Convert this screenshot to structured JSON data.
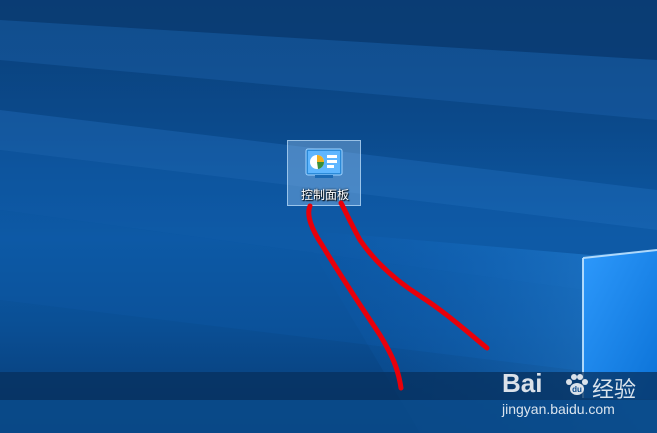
{
  "desktop": {
    "icons": [
      {
        "label": "控制面板",
        "icon": "control-panel-icon",
        "selected": true
      }
    ]
  },
  "watermark": {
    "brand": "Bai",
    "brand_paw": "du",
    "cn": "经验",
    "url": "jingyan.baidu.com"
  },
  "colors": {
    "annotation": "#e8000a",
    "selection": "#add6ff",
    "desktop_blue": "#0b4a8c"
  }
}
